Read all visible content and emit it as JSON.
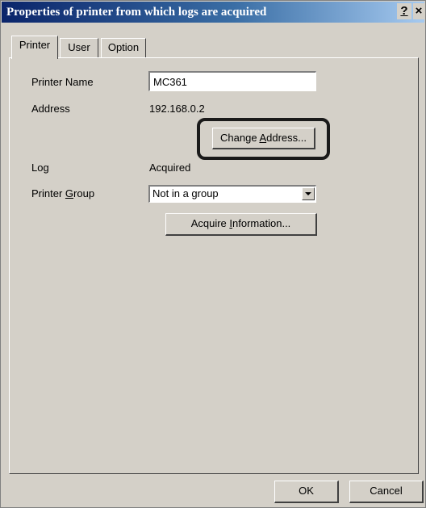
{
  "window": {
    "title": "Properties of printer from which logs are acquired",
    "help_label": "?",
    "close_label": "×"
  },
  "tabs": [
    {
      "label": "Printer",
      "active": true
    },
    {
      "label": "User",
      "active": false
    },
    {
      "label": "Option",
      "active": false
    }
  ],
  "form": {
    "printer_name_label": "Printer Name",
    "printer_name_value": "MC361",
    "address_label": "Address",
    "address_value": "192.168.0.2",
    "change_address_button": {
      "before": "Change ",
      "accel": "A",
      "after": "ddress..."
    },
    "log_label": "Log",
    "log_value": "Acquired",
    "printer_group_label": {
      "before": "Printer ",
      "accel": "G",
      "after": "roup"
    },
    "printer_group_value": "Not in a group",
    "acquire_button": {
      "before": "Acquire ",
      "accel": "I",
      "after": "nformation..."
    }
  },
  "footer": {
    "ok_label": "OK",
    "cancel_label": "Cancel"
  },
  "colors": {
    "dialog_bg": "#d4d0c8",
    "title_start": "#0a246a",
    "title_end": "#a6caf0",
    "highlight_ring": "#1a1a1a"
  }
}
